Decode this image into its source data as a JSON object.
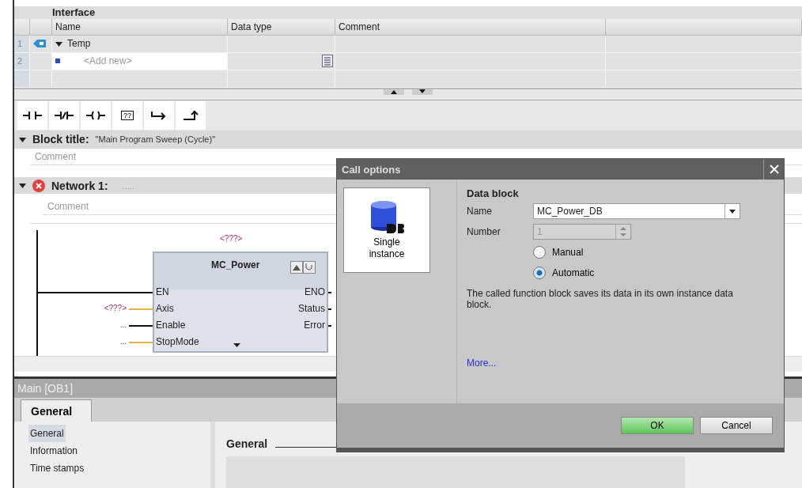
{
  "interface": {
    "title": "Interface",
    "columns": [
      "Name",
      "Data type",
      "Comment"
    ],
    "rows": [
      {
        "number": "1",
        "name": "Temp",
        "kind": "section",
        "expanded": true
      },
      {
        "number": "2",
        "name": "<Add new>",
        "kind": "placeholder"
      }
    ]
  },
  "toolbar": {
    "box_label": "??"
  },
  "block": {
    "label": "Block title:",
    "title": "\"Main Program Sweep (Cycle)\"",
    "comment": "Comment",
    "expanded": true
  },
  "network": {
    "label": "Network 1:",
    "title": ".....",
    "error": true,
    "expanded": true,
    "comment": "Comment",
    "fb": {
      "operand": "<???>",
      "name": "MC_Power",
      "inputs": [
        {
          "name": "EN",
          "kind": "rail"
        },
        {
          "name": "Axis",
          "operand": "<???>",
          "kind": "param"
        },
        {
          "name": "Enable",
          "operand": "...",
          "kind": "bool"
        },
        {
          "name": "StopMode",
          "operand": "...",
          "kind": "param"
        }
      ],
      "outputs": [
        "ENO",
        "Status",
        "Error"
      ]
    }
  },
  "dialog": {
    "title": "Call options",
    "options": [
      {
        "label": "Single instance",
        "selected": true
      }
    ],
    "section": "Data block",
    "name_label": "Name",
    "name_value": "MC_Power_DB",
    "number_label": "Number",
    "number_value": "1",
    "number_disabled": true,
    "modes": [
      {
        "label": "Manual",
        "selected": false
      },
      {
        "label": "Automatic",
        "selected": true
      }
    ],
    "description": "The called function block saves its data in its own instance data block.",
    "more_link": "More...",
    "buttons": [
      {
        "label": "OK",
        "kind": "primary"
      },
      {
        "label": "Cancel",
        "kind": "secondary"
      }
    ]
  },
  "inspector": {
    "title": "Main [OB1]",
    "tabs": [
      {
        "label": "General",
        "selected": true
      }
    ],
    "nav": [
      {
        "label": "General",
        "selected": true
      },
      {
        "label": "Information",
        "selected": false
      },
      {
        "label": "Time stamps",
        "selected": false
      }
    ],
    "section": "General"
  }
}
